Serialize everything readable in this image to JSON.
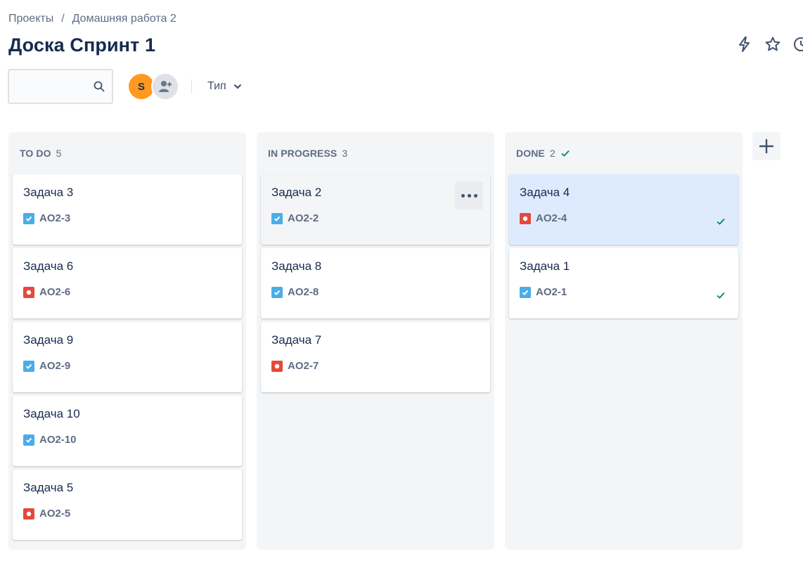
{
  "breadcrumb": {
    "root": "Проекты",
    "separator": "/",
    "project": "Домашняя работа 2"
  },
  "page": {
    "title": "Доска Спринт 1"
  },
  "search": {
    "value": "",
    "placeholder": ""
  },
  "avatars": {
    "user_initial": "S"
  },
  "filter": {
    "type_label": "Тип"
  },
  "columns": [
    {
      "name": "TO DO",
      "count": "5",
      "cards": [
        {
          "title": "Задача 3",
          "key": "AO2-3",
          "type": "task-icon"
        },
        {
          "title": "Задача 6",
          "key": "AO2-6",
          "type": "bug-icon"
        },
        {
          "title": "Задача 9",
          "key": "AO2-9",
          "type": "task-icon"
        },
        {
          "title": "Задача 10",
          "key": "AO2-10",
          "type": "task-icon"
        },
        {
          "title": "Задача 5",
          "key": "AO2-5",
          "type": "bug-icon"
        }
      ]
    },
    {
      "name": "IN PROGRESS",
      "count": "3",
      "cards": [
        {
          "title": "Задача 2",
          "key": "AO2-2",
          "type": "task-icon"
        },
        {
          "title": "Задача 8",
          "key": "AO2-8",
          "type": "task-icon"
        },
        {
          "title": "Задача 7",
          "key": "AO2-7",
          "type": "bug-icon"
        }
      ]
    },
    {
      "name": "DONE",
      "count": "2",
      "cards": [
        {
          "title": "Задача 4",
          "key": "AO2-4",
          "type": "bug-icon"
        },
        {
          "title": "Задача 1",
          "key": "AO2-1",
          "type": "task-icon"
        }
      ]
    }
  ],
  "colors": {
    "task": "#4bade8",
    "bug": "#e5493a",
    "done_check": "#00875a",
    "selected_card": "#deebff",
    "avatar": "#ff991f"
  }
}
